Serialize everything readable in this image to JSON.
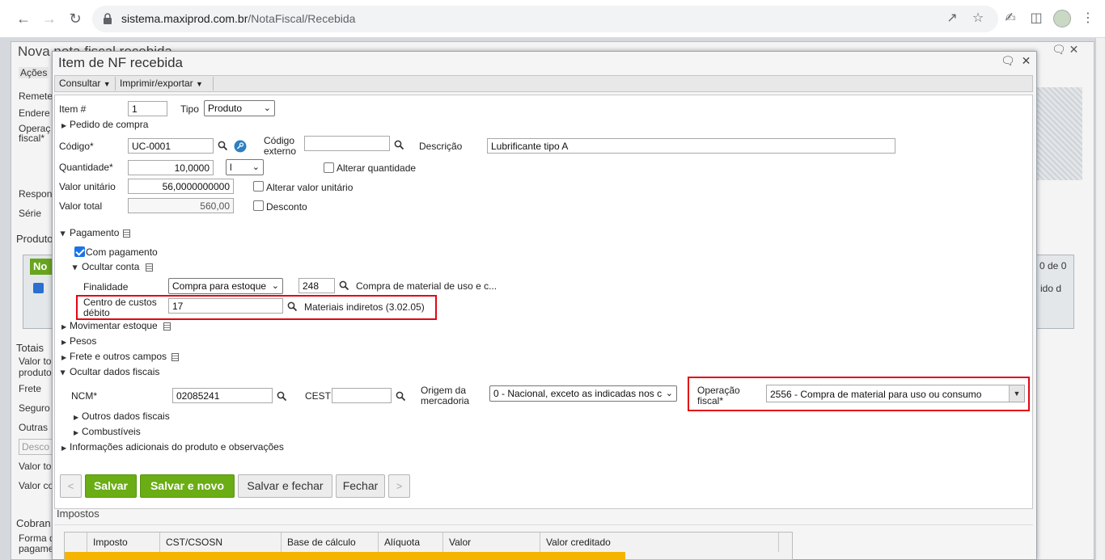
{
  "browser": {
    "url_domain": "sistema.maxiprod.com.br",
    "url_path": "/NotaFiscal/Recebida"
  },
  "background": {
    "title": "Nova nota fiscal recebida",
    "acoes": "Ações",
    "remetente": "Remete",
    "endereco": "Endere",
    "operacao": "Operaç",
    "fiscal": "fiscal*",
    "responsavel": "Respon",
    "serie": "Série",
    "produtos": "Produto",
    "novo": "No",
    "paging": "0 de 0",
    "col_tail": "ido d",
    "totais": "Totais",
    "valor_total": "Valor to",
    "produto": "produto",
    "frete": "Frete",
    "seguro": "Seguro",
    "outras": "Outras",
    "desconto": "Desco",
    "valor_to2": "Valor to",
    "valor_co": "Valor co",
    "cobranca": "Cobran",
    "forma": "Forma d",
    "pagame": "pagame"
  },
  "modal": {
    "title": "Item de NF recebida",
    "toolbar": {
      "consultar": "Consultar",
      "imprimir": "Imprimir/exportar"
    },
    "item": {
      "label": "Item #",
      "value": "1"
    },
    "tipo": {
      "label": "Tipo",
      "value": "Produto"
    },
    "pedido_compra": "Pedido de compra",
    "codigo": {
      "label": "Código*",
      "value": "UC-0001"
    },
    "codigo_externo": {
      "label_line1": "Código",
      "label_line2": "externo",
      "value": ""
    },
    "descricao": {
      "label": "Descrição",
      "value": "Lubrificante tipo A"
    },
    "quantidade": {
      "label": "Quantidade*",
      "value": "10,0000",
      "unit": "l"
    },
    "alterar_quantidade": "Alterar quantidade",
    "valor_unitario": {
      "label": "Valor unitário",
      "value": "56,0000000000"
    },
    "alterar_valor_unitario": "Alterar valor unitário",
    "valor_total": {
      "label": "Valor total",
      "value": "560,00"
    },
    "desconto": "Desconto",
    "pagamento": {
      "header": "Pagamento",
      "com_pagamento": "Com pagamento",
      "ocultar_conta": "Ocultar conta",
      "finalidade": {
        "label": "Finalidade",
        "value": "Compra para estoque",
        "code": "248",
        "desc": "Compra de material de uso e c..."
      },
      "centro_custos": {
        "label_line1": "Centro de custos",
        "label_line2": "débito",
        "value": "17",
        "desc": "Materiais indiretos (3.02.05)"
      }
    },
    "sections": {
      "movimentar_estoque": "Movimentar estoque",
      "pesos": "Pesos",
      "frete": "Frete e outros campos",
      "ocultar_fiscais": "Ocultar dados fiscais",
      "outros_fiscais": "Outros dados fiscais",
      "combustiveis": "Combustíveis",
      "info_adicionais": "Informações adicionais do produto e observações"
    },
    "fiscal": {
      "ncm": {
        "label": "NCM*",
        "value": "02085241"
      },
      "cest": {
        "label": "CEST",
        "value": ""
      },
      "origem": {
        "label_line1": "Origem da",
        "label_line2": "mercadoria",
        "value": "0 - Nacional, exceto as indicadas nos c"
      },
      "operacao": {
        "label_line1": "Operação",
        "label_line2": "fiscal*",
        "value": "2556 - Compra de material para uso ou consumo"
      }
    },
    "buttons": {
      "prev": "<",
      "salvar": "Salvar",
      "salvar_novo": "Salvar e novo",
      "salvar_fechar": "Salvar e fechar",
      "fechar": "Fechar",
      "next": ">"
    },
    "impostos": {
      "title": "Impostos",
      "columns": [
        "Imposto",
        "CST/CSOSN",
        "Base de cálculo",
        "Alíquota",
        "Valor",
        "Valor creditado"
      ]
    }
  }
}
